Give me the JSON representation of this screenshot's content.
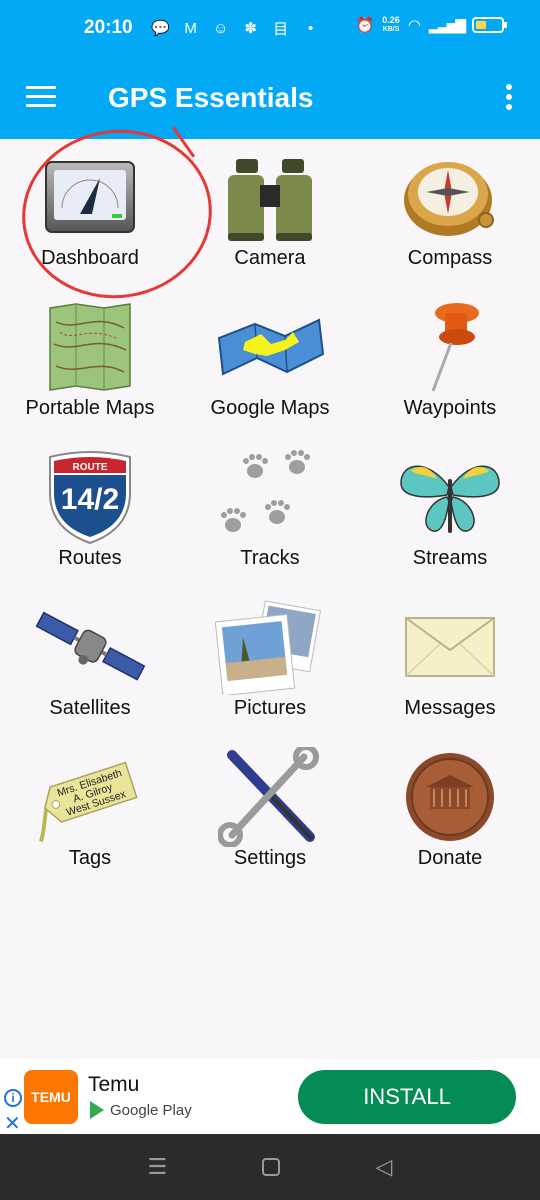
{
  "status": {
    "time": "20:10",
    "speed_top": "0.26",
    "speed_bottom": "KB/S"
  },
  "app": {
    "title": "GPS Essentials"
  },
  "tiles": [
    {
      "label": "Dashboard",
      "icon": "dashboard-gauge-icon"
    },
    {
      "label": "Camera",
      "icon": "binoculars-icon"
    },
    {
      "label": "Compass",
      "icon": "compass-icon"
    },
    {
      "label": "Portable Maps",
      "icon": "topo-map-icon"
    },
    {
      "label": "Google Maps",
      "icon": "folded-map-icon"
    },
    {
      "label": "Waypoints",
      "icon": "push-pin-icon"
    },
    {
      "label": "Routes",
      "icon": "route-shield-icon"
    },
    {
      "label": "Tracks",
      "icon": "paw-prints-icon"
    },
    {
      "label": "Streams",
      "icon": "butterfly-icon"
    },
    {
      "label": "Satellites",
      "icon": "satellite-icon"
    },
    {
      "label": "Pictures",
      "icon": "photos-icon"
    },
    {
      "label": "Messages",
      "icon": "envelope-icon"
    },
    {
      "label": "Tags",
      "icon": "luggage-tag-icon"
    },
    {
      "label": "Settings",
      "icon": "tools-icon"
    },
    {
      "label": "Donate",
      "icon": "penny-icon"
    }
  ],
  "route_shield": {
    "top": "ROUTE",
    "number": "14/2"
  },
  "tag_text": [
    "Mrs. Elisabeth",
    "A. Gilroy",
    "West Sussex"
  ],
  "ad": {
    "name": "Temu",
    "store": "Google Play",
    "logo_text": "TEMU",
    "install_label": "INSTALL"
  },
  "colors": {
    "primary": "#03a9f4",
    "install": "#058c54",
    "annotation": "#e53935"
  }
}
